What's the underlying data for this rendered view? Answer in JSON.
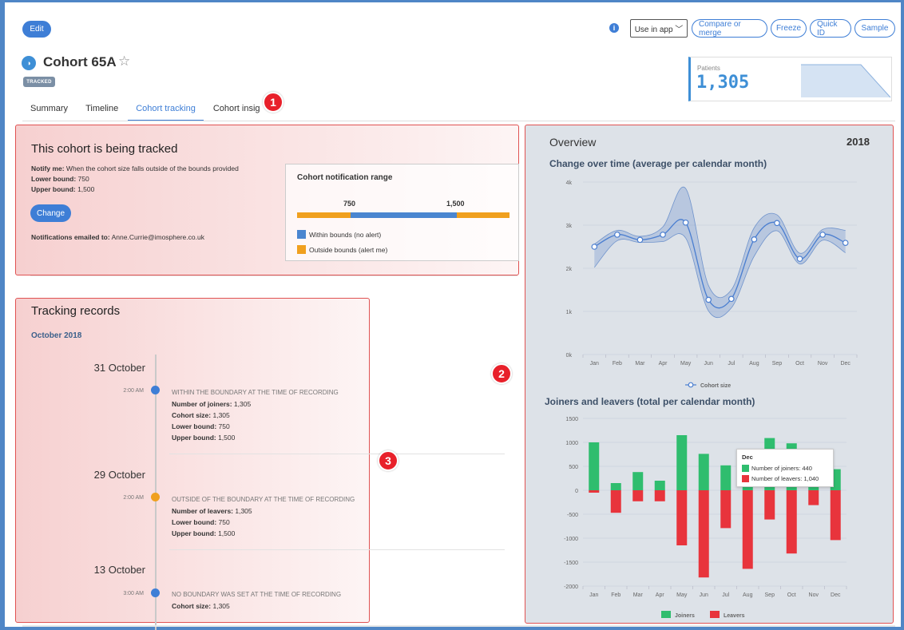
{
  "toolbar": {
    "edit_label": "Edit",
    "info_icon": "info-icon",
    "use_in_app_label": "Use in app ﹀",
    "compare_label": "Compare or merge",
    "freeze_label": "Freeze",
    "quick_id_label": "Quick ID",
    "sample_label": "Sample"
  },
  "header": {
    "title": "Cohort 65A",
    "badge": "TRACKED",
    "patients_label": "Patients",
    "patients_value": "1,305"
  },
  "tabs": [
    {
      "label": "Summary"
    },
    {
      "label": "Timeline"
    },
    {
      "label": "Cohort tracking"
    },
    {
      "label": "Cohort insig"
    }
  ],
  "callouts": {
    "one": "1",
    "two": "2",
    "three": "3"
  },
  "tracking": {
    "title": "This cohort is being tracked",
    "notify_label": "Notify me:",
    "notify_text": " When the cohort size falls outside of the bounds provided",
    "lower_label": "Lower bound:",
    "lower_value": " 750",
    "upper_label": "Upper bound:",
    "upper_value": " 1,500",
    "change_label": "Change",
    "emailed_label": "Notifications emailed to:",
    "emailed_value": " Anne.Currie@imosphere.co.uk"
  },
  "notification_range": {
    "title": "Cohort notification range",
    "low": "750",
    "high": "1,500",
    "within_label": "Within bounds (no alert)",
    "outside_label": "Outside bounds (alert me)",
    "within_color": "#4a86d0",
    "outside_color": "#f0a01e"
  },
  "records": {
    "title": "Tracking records",
    "month": "October 2018",
    "entries": [
      {
        "date": "31 October",
        "time": "2:00 AM",
        "heading": "WITHIN THE BOUNDARY AT THE TIME OF RECORDING",
        "lines": [
          {
            "k": "Number of joiners:",
            "v": " 1,305"
          },
          {
            "k": "Cohort size:",
            "v": " 1,305"
          },
          {
            "k": "Lower bound:",
            "v": " 750"
          },
          {
            "k": "Upper bound:",
            "v": " 1,500"
          }
        ],
        "dot_color": "#3e7ed6"
      },
      {
        "date": "29 October",
        "time": "2:00 AM",
        "heading": "OUTSIDE OF THE BOUNDARY AT THE TIME OF RECORDING",
        "lines": [
          {
            "k": "Number of leavers:",
            "v": " 1,305"
          },
          {
            "k": "Lower bound:",
            "v": " 750"
          },
          {
            "k": "Upper bound:",
            "v": " 1,500"
          }
        ],
        "dot_color": "#f0a01e"
      },
      {
        "date": "13 October",
        "time": "3:00 AM",
        "heading": "NO BOUNDARY WAS SET AT THE TIME OF RECORDING",
        "lines": [
          {
            "k": "Cohort size:",
            "v": " 1,305"
          }
        ],
        "dot_color": "#3e7ed6"
      }
    ]
  },
  "overview": {
    "title": "Overview",
    "year": "2018"
  },
  "chart_data": [
    {
      "type": "line",
      "title": "Change over time (average per calendar month)",
      "categories": [
        "Jan",
        "Feb",
        "Mar",
        "Apr",
        "May",
        "Jun",
        "Jul",
        "Aug",
        "Sep",
        "Oct",
        "Nov",
        "Dec"
      ],
      "series": [
        {
          "name": "Cohort size",
          "values": [
            2500,
            2780,
            2660,
            2780,
            3060,
            1270,
            1290,
            2670,
            3050,
            2220,
            2780,
            2590
          ]
        }
      ],
      "band_upper": [
        2560,
        2880,
        2740,
        2960,
        3850,
        1600,
        1500,
        2940,
        3240,
        2350,
        2900,
        2880
      ],
      "band_lower": [
        2020,
        2640,
        2600,
        2620,
        2700,
        1010,
        1080,
        2280,
        2870,
        2100,
        2650,
        2360
      ],
      "yticks": [
        "0k",
        "1k",
        "2k",
        "3k",
        "4k"
      ],
      "ylim": [
        0,
        4000
      ],
      "legend": "bottom",
      "color": "#4a7ed0"
    },
    {
      "type": "bar",
      "title": "Joiners and leavers (total per calendar month)",
      "categories": [
        "Jan",
        "Feb",
        "Mar",
        "Apr",
        "May",
        "Jun",
        "Jul",
        "Aug",
        "Sep",
        "Oct",
        "Nov",
        "Dec"
      ],
      "series": [
        {
          "name": "Joiners",
          "values": [
            1000,
            150,
            380,
            200,
            1150,
            760,
            520,
            860,
            1090,
            980,
            180,
            440
          ],
          "color": "#2fbd6e"
        },
        {
          "name": "Leavers",
          "values": [
            -50,
            -470,
            -230,
            -230,
            -1150,
            -1820,
            -790,
            -1640,
            -610,
            -1320,
            -310,
            -1040
          ],
          "color": "#e8343c"
        }
      ],
      "yticks": [
        "1500",
        "1000",
        "500",
        "0",
        "-500",
        "-1000",
        "-1500",
        "-2000"
      ],
      "ylim": [
        -2000,
        1500
      ],
      "legend": "bottom",
      "tooltip": {
        "title": "Dec",
        "joiners": "Number of joiners: 440",
        "leavers": "Number of leavers: 1,040"
      }
    }
  ]
}
